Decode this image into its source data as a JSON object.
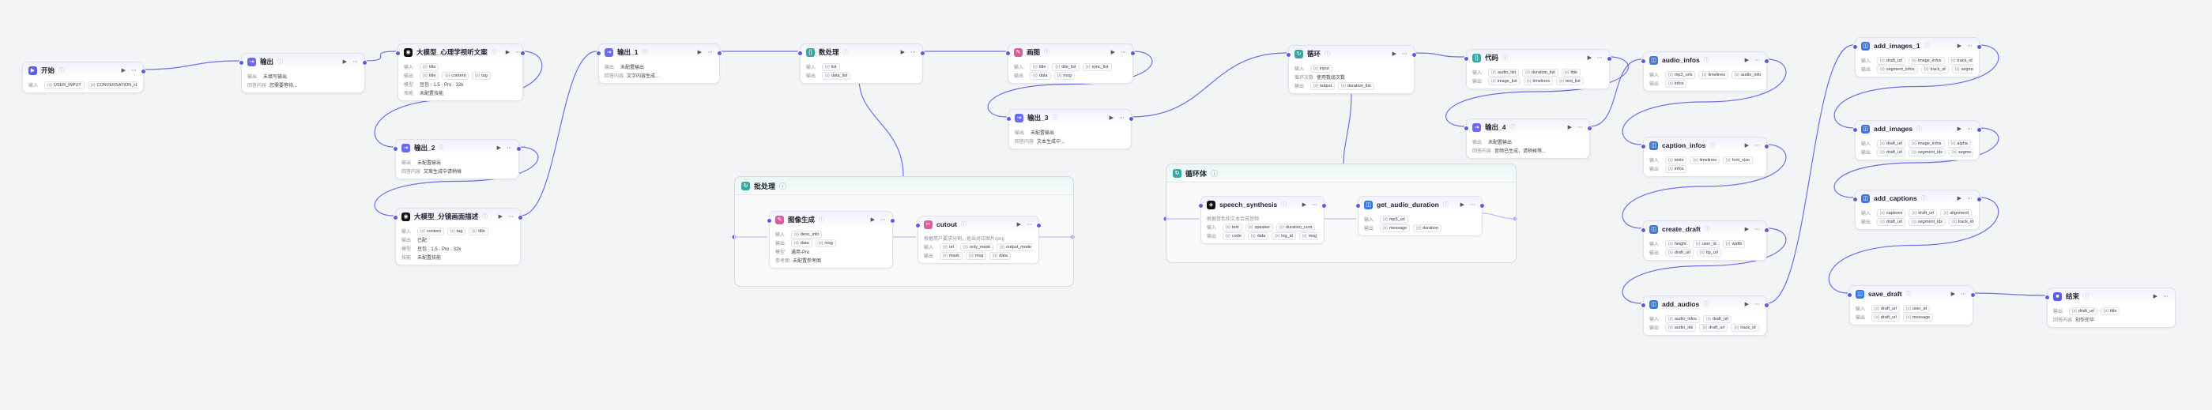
{
  "colors": {
    "wire": "#6e6ee8",
    "accent": "#5b5ce2"
  },
  "groups": [
    {
      "id": "g1",
      "title": "批处理",
      "icon": "loop-icon"
    },
    {
      "id": "g2",
      "title": "循环体",
      "icon": "loop-icon"
    }
  ],
  "nodes": [
    {
      "id": "start",
      "title": "开始",
      "color": "#5b5ce2",
      "glyph": "▶",
      "rows": [
        {
          "label": "输入",
          "tags": [
            "USER_INPUT",
            "CONVERSATION_H..."
          ]
        }
      ]
    },
    {
      "id": "out0",
      "title": "输出",
      "color": "#6a6af0",
      "glyph": "⇥",
      "rows": [
        {
          "label": "输出",
          "text": "未填写输出"
        },
        {
          "label": "回答内容",
          "text": "您需要等待..."
        }
      ]
    },
    {
      "id": "llm1",
      "title": "大模型_心理学视听文案",
      "color": "#111111",
      "glyph": "◉",
      "rows": [
        {
          "label": "输入",
          "tags": [
            "title"
          ]
        },
        {
          "label": "输出",
          "tags": [
            "title",
            "content",
            "tag"
          ]
        },
        {
          "label": "模型",
          "text": "豆包 · 1.5 · Pro · 32k"
        },
        {
          "label": "技能",
          "text": "未配置技能"
        }
      ]
    },
    {
      "id": "out2",
      "title": "输出_2",
      "color": "#6a6af0",
      "glyph": "⇥",
      "rows": [
        {
          "label": "输出",
          "text": "未配置输出"
        },
        {
          "label": "回答内容",
          "text": "文案生成中请稍候"
        }
      ]
    },
    {
      "id": "llm2",
      "title": "大模型_分镜画面描述",
      "color": "#111111",
      "glyph": "◉",
      "rows": [
        {
          "label": "输入",
          "tags": [
            "content",
            "tag",
            "title"
          ]
        },
        {
          "label": "输出",
          "text": "已配"
        },
        {
          "label": "模型",
          "text": "豆包 · 1.5 · Pro · 32k"
        },
        {
          "label": "技能",
          "text": "未配置技能"
        }
      ]
    },
    {
      "id": "out1",
      "title": "输出_1",
      "color": "#6a6af0",
      "glyph": "⇥",
      "rows": [
        {
          "label": "输出",
          "text": "未配置输出"
        },
        {
          "label": "回答内容",
          "text": "文字内容生成..."
        }
      ]
    },
    {
      "id": "code1",
      "title": "数处理",
      "color": "#3aa6a0",
      "glyph": "{}",
      "rows": [
        {
          "label": "输入",
          "tags": [
            "list"
          ]
        },
        {
          "label": "输出",
          "tags": [
            "data_list"
          ]
        }
      ]
    },
    {
      "id": "merge",
      "title": "画图",
      "color": "#e05aa0",
      "glyph": "✎",
      "rows": [
        {
          "label": "输入",
          "tags": [
            "title",
            "title_list",
            "sync_list"
          ]
        },
        {
          "label": "输出",
          "tags": [
            "data",
            "msg"
          ]
        }
      ]
    },
    {
      "id": "out3",
      "title": "输出_3",
      "color": "#6a6af0",
      "glyph": "⇥",
      "rows": [
        {
          "label": "输出",
          "text": "未配置输出"
        },
        {
          "label": "回答内容",
          "text": "文本生成中..."
        }
      ]
    },
    {
      "id": "imggen",
      "title": "图像生成",
      "color": "#e05aa0",
      "glyph": "✎",
      "rows": [
        {
          "label": "输入",
          "tags": [
            "desc_info"
          ]
        },
        {
          "label": "输出",
          "tags": [
            "data",
            "msg"
          ]
        },
        {
          "label": "模型",
          "text": "通用-Pro"
        },
        {
          "label": "参考图",
          "text": "未配置参考图"
        }
      ]
    },
    {
      "id": "cutout",
      "title": "cutout",
      "color": "#e05aa0",
      "glyph": "✂",
      "desc": "根据用户要求分割，抠出对应图片/png",
      "rows": [
        {
          "label": "输入",
          "tags": [
            "url",
            "only_mask",
            "output_mode"
          ]
        },
        {
          "label": "输出",
          "tags": [
            "mask",
            "msg",
            "data"
          ]
        }
      ]
    },
    {
      "id": "loop",
      "title": "循环",
      "color": "#3aa6a0",
      "glyph": "↻",
      "rows": [
        {
          "label": "输入",
          "tags": [
            "input"
          ]
        },
        {
          "label": "循环次数",
          "text": "使用数组次数"
        },
        {
          "label": "输出",
          "tags": [
            "output",
            "duration_list"
          ]
        }
      ]
    },
    {
      "id": "tts",
      "title": "speech_synthesis",
      "color": "#111111",
      "glyph": "◈",
      "desc": "根据音色和文本合成音频",
      "rows": [
        {
          "label": "输入",
          "tags": [
            "text",
            "speaker",
            "duration_cont"
          ]
        },
        {
          "label": "输出",
          "tags": [
            "code",
            "data",
            "log_id",
            "msg"
          ]
        }
      ]
    },
    {
      "id": "dur",
      "title": "get_audio_duration",
      "color": "#3a78e0",
      "glyph": "◫",
      "rows": [
        {
          "label": "输入",
          "tags": [
            "mp3_url"
          ]
        },
        {
          "label": "输出",
          "tags": [
            "message",
            "duration"
          ]
        }
      ]
    },
    {
      "id": "code2",
      "title": "代码",
      "color": "#3aa6a0",
      "glyph": "{}",
      "rows": [
        {
          "label": "输入",
          "tags": [
            "audio_list",
            "duration_list",
            "title"
          ]
        },
        {
          "label": "输出",
          "tags": [
            "image_list",
            "timelines",
            "text_list"
          ]
        }
      ]
    },
    {
      "id": "out4",
      "title": "输出_4",
      "color": "#6a6af0",
      "glyph": "⇥",
      "rows": [
        {
          "label": "输出",
          "text": "未配置输出"
        },
        {
          "label": "回答内容",
          "text": "音频已生成，请稍候等..."
        }
      ]
    },
    {
      "id": "ainfo",
      "title": "audio_infos",
      "color": "#3a78e0",
      "glyph": "◫",
      "rows": [
        {
          "label": "输入",
          "tags": [
            "mp3_urls",
            "timelines",
            "audio_info"
          ]
        },
        {
          "label": "输出",
          "tags": [
            "infos"
          ]
        }
      ]
    },
    {
      "id": "cinfo",
      "title": "caption_infos",
      "color": "#3a78e0",
      "glyph": "◫",
      "rows": [
        {
          "label": "输入",
          "tags": [
            "texts",
            "timelines",
            "font_size"
          ]
        },
        {
          "label": "输出",
          "tags": [
            "infos"
          ]
        }
      ]
    },
    {
      "id": "cdraft",
      "title": "create_draft",
      "color": "#3a78e0",
      "glyph": "◫",
      "rows": [
        {
          "label": "输入",
          "tags": [
            "height",
            "user_id",
            "width"
          ]
        },
        {
          "label": "输出",
          "tags": [
            "draft_url",
            "tip_url"
          ]
        }
      ]
    },
    {
      "id": "aaudio",
      "title": "add_audios",
      "color": "#3a78e0",
      "glyph": "◫",
      "rows": [
        {
          "label": "输入",
          "tags": [
            "audio_infos",
            "draft_url"
          ]
        },
        {
          "label": "输出",
          "tags": [
            "audio_ids",
            "draft_url",
            "track_id"
          ]
        }
      ]
    },
    {
      "id": "aimg2",
      "title": "add_images_1",
      "color": "#3a78e0",
      "glyph": "◫",
      "rows": [
        {
          "label": "输入",
          "tags": [
            "draft_url",
            "image_infos",
            "track_id"
          ]
        },
        {
          "label": "输出",
          "tags": [
            "segment_infos",
            "track_id",
            "segme..."
          ]
        }
      ]
    },
    {
      "id": "aimg",
      "title": "add_images",
      "color": "#3a78e0",
      "glyph": "◫",
      "rows": [
        {
          "label": "输入",
          "tags": [
            "draft_url",
            "image_infos",
            "alpha"
          ]
        },
        {
          "label": "输出",
          "tags": [
            "draft_url",
            "segment_ids",
            "segme..."
          ]
        }
      ]
    },
    {
      "id": "acap",
      "title": "add_captions",
      "color": "#3a78e0",
      "glyph": "◫",
      "rows": [
        {
          "label": "输入",
          "tags": [
            "captions",
            "draft_url",
            "alignment"
          ]
        },
        {
          "label": "输出",
          "tags": [
            "draft_url",
            "segment_ids",
            "track_id"
          ]
        }
      ]
    },
    {
      "id": "save",
      "title": "save_draft",
      "color": "#3a78e0",
      "glyph": "◫",
      "rows": [
        {
          "label": "输入",
          "tags": [
            "draft_url",
            "user_id"
          ]
        },
        {
          "label": "输出",
          "tags": [
            "draft_url",
            "message"
          ]
        }
      ]
    },
    {
      "id": "end",
      "title": "结束",
      "color": "#5b5ce2",
      "glyph": "■",
      "rows": [
        {
          "label": "输出",
          "tags": [
            "draft_url",
            "title"
          ]
        },
        {
          "label": "回答内容",
          "text": "创作完毕"
        }
      ]
    }
  ]
}
